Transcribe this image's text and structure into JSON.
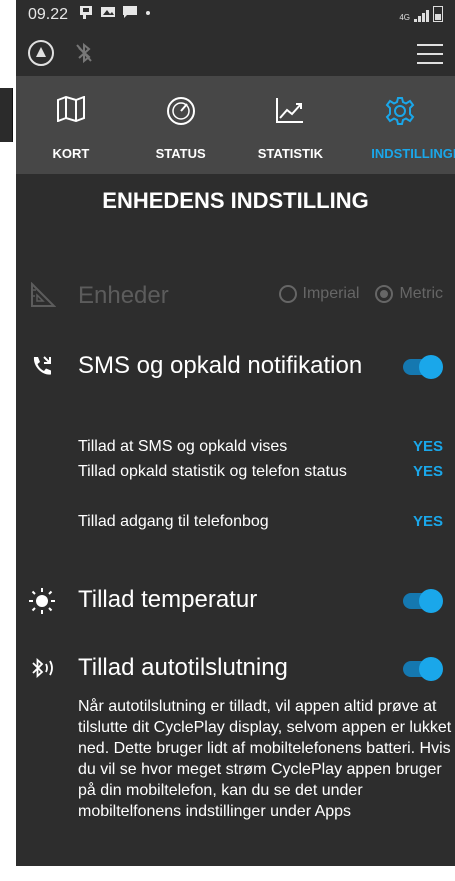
{
  "status_bar": {
    "time": "09.22",
    "network": "4G"
  },
  "tabs": [
    {
      "label": "KORT",
      "icon": "map-icon",
      "active": false
    },
    {
      "label": "STATUS",
      "icon": "speedometer-icon",
      "active": false
    },
    {
      "label": "STATISTIK",
      "icon": "chart-icon",
      "active": false
    },
    {
      "label": "INDSTILLINGER",
      "icon": "gear-icon",
      "active": true
    }
  ],
  "page_title": "ENHEDENS INDSTILLING",
  "units": {
    "label": "Enheder",
    "options": [
      {
        "label": "Imperial",
        "selected": false
      },
      {
        "label": "Metric",
        "selected": true
      }
    ]
  },
  "sms": {
    "label": "SMS og opkald notifikation",
    "enabled": true,
    "items": [
      {
        "label": "Tillad at SMS og opkald vises",
        "value": "YES"
      },
      {
        "label": "Tillad opkald statistik og telefon status",
        "value": "YES"
      },
      {
        "label": "Tillad adgang til telefonbog",
        "value": "YES"
      }
    ]
  },
  "temperature": {
    "label": "Tillad temperatur",
    "enabled": true
  },
  "autoconnect": {
    "label": "Tillad autotilslutning",
    "enabled": true,
    "description": "Når autotilslutning er tilladt, vil appen altid prøve at tilslutte dit CyclePlay display, selvom appen er lukket ned. Dette bruger lidt af mobiltelefonens batteri. Hvis du vil se hvor meget strøm CyclePlay appen bruger på din mobiltelefon, kan du se det under mobiltelfonens indstillinger under Apps"
  },
  "colors": {
    "accent": "#1aa7ea",
    "background": "#2d2d2d",
    "tab_bar": "#474747",
    "muted": "#5c5c5c"
  }
}
